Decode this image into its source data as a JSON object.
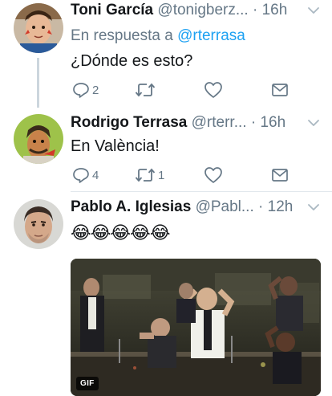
{
  "tweets": [
    {
      "name": "Toni García",
      "handle": "@tonigberz...",
      "separator": "·",
      "time": "16h",
      "reply_prefix": "En respuesta a",
      "reply_mention": "@rterrasa",
      "text": "¿Dónde es esto?",
      "actions": {
        "reply_count": "2",
        "retweet_count": "",
        "like_count": ""
      }
    },
    {
      "name": "Rodrigo Terrasa",
      "handle": "@rterr...",
      "separator": "·",
      "time": "16h",
      "text": "En València!",
      "actions": {
        "reply_count": "4",
        "retweet_count": "1",
        "like_count": ""
      }
    },
    {
      "name": "Pablo A. Iglesias",
      "handle": "@Pabl...",
      "separator": "·",
      "time": "12h",
      "text": "😂😂😂😂😂",
      "media": {
        "badge": "GIF"
      }
    }
  ],
  "colors": {
    "text": "#14171a",
    "secondary": "#657786",
    "link": "#1da1f2",
    "thread_line": "#ccd6dd"
  },
  "icons": {
    "reply": "reply-icon",
    "retweet": "retweet-icon",
    "like": "heart-icon",
    "dm": "envelope-icon",
    "more": "chevron-down-icon"
  }
}
